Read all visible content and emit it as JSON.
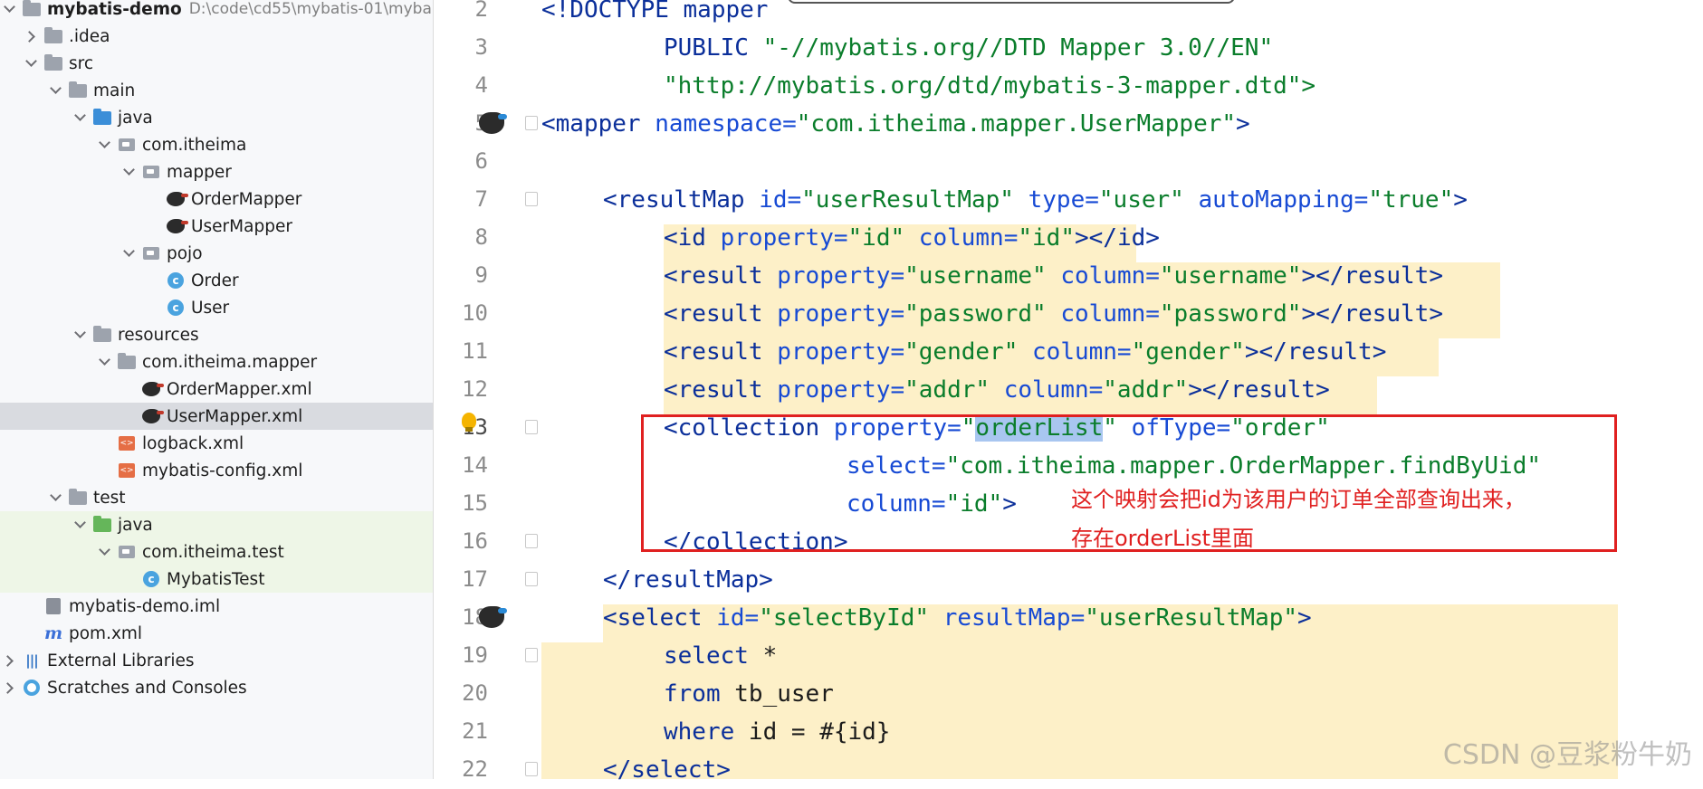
{
  "project_tree": {
    "root": {
      "name": "mybatis-demo",
      "path": "D:\\code\\cd55\\mybatis-01\\myba"
    },
    "items": [
      {
        "label": ".idea"
      },
      {
        "label": "src"
      },
      {
        "label": "main"
      },
      {
        "label": "java"
      },
      {
        "label": "com.itheima"
      },
      {
        "label": "mapper"
      },
      {
        "label": "OrderMapper"
      },
      {
        "label": "UserMapper"
      },
      {
        "label": "pojo"
      },
      {
        "label": "Order"
      },
      {
        "label": "User"
      },
      {
        "label": "resources"
      },
      {
        "label": "com.itheima.mapper"
      },
      {
        "label": "OrderMapper.xml"
      },
      {
        "label": "UserMapper.xml"
      },
      {
        "label": "logback.xml"
      },
      {
        "label": "mybatis-config.xml"
      },
      {
        "label": "test"
      },
      {
        "label": "java"
      },
      {
        "label": "com.itheima.test"
      },
      {
        "label": "MybatisTest"
      },
      {
        "label": "mybatis-demo.iml"
      },
      {
        "label": "pom.xml"
      },
      {
        "label": "External Libraries"
      },
      {
        "label": "Scratches and Consoles"
      }
    ]
  },
  "editor": {
    "line_numbers": [
      "2",
      "3",
      "4",
      "5",
      "6",
      "7",
      "8",
      "9",
      "10",
      "11",
      "12",
      "13",
      "14",
      "15",
      "16",
      "17",
      "18",
      "19",
      "20",
      "21",
      "22"
    ],
    "code": {
      "l2": "<!DOCTYPE mapper",
      "l3_a": "PUBLIC ",
      "l3_b": "\"-//mybatis.org//DTD Mapper 3.0//EN\"",
      "l4": "\"http://mybatis.org/dtd/mybatis-3-mapper.dtd\">",
      "l5_tag": "<mapper ",
      "l5_attr": "namespace=",
      "l5_val": "\"com.itheima.mapper.UserMapper\"",
      "l5_end": ">",
      "l7_tag": "<resultMap ",
      "l7_a1": "id=",
      "l7_v1": "\"userResultMap\"",
      "l7_a2": " type=",
      "l7_v2": "\"user\"",
      "l7_a3": " autoMapping=",
      "l7_v3": "\"true\"",
      "l7_end": ">",
      "l8_tag": "<id ",
      "l8_a1": "property=",
      "l8_v1": "\"id\"",
      "l8_a2": " column=",
      "l8_v2": "\"id\"",
      "l8_end": "></id>",
      "l9_tag": "<result ",
      "l9_a1": "property=",
      "l9_v1": "\"username\"",
      "l9_a2": " column=",
      "l9_v2": "\"username\"",
      "l9_end": "></result>",
      "l10_tag": "<result ",
      "l10_a1": "property=",
      "l10_v1": "\"password\"",
      "l10_a2": " column=",
      "l10_v2": "\"password\"",
      "l10_end": "></result>",
      "l11_tag": "<result ",
      "l11_a1": "property=",
      "l11_v1": "\"gender\"",
      "l11_a2": " column=",
      "l11_v2": "\"gender\"",
      "l11_end": "></result>",
      "l12_tag": "<result ",
      "l12_a1": "property=",
      "l12_v1": "\"addr\"",
      "l12_a2": " column=",
      "l12_v2": "\"addr\"",
      "l12_end": "></result>",
      "l13_tag": "<collection ",
      "l13_a1": "property=",
      "l13_v1a": "\"",
      "l13_v1sel": "orderList",
      "l13_v1b": "\"",
      "l13_a2": " ofType=",
      "l13_v2": "\"order\"",
      "l14_a": "select=",
      "l14_v": "\"com.itheima.mapper.OrderMapper.findByUid\"",
      "l15_a": "column=",
      "l15_v": "\"id\"",
      "l15_end": ">",
      "l16": "</collection>",
      "l17": "</resultMap>",
      "l18_tag": "<select ",
      "l18_a1": "id=",
      "l18_v1": "\"selectById\"",
      "l18_a2": " resultMap=",
      "l18_v2": "\"userResultMap\"",
      "l18_end": ">",
      "l19_kw": "select ",
      "l19_rest": "*",
      "l20_kw": "from ",
      "l20_rest": "tb_user",
      "l21_kw": "where ",
      "l21_rest": "id = #{id}",
      "l22": "</select>"
    },
    "annotation": {
      "line1": "这个映射会把id为该用户的订单全部查询出来，",
      "line2": "存在orderList里面"
    }
  },
  "watermark": "CSDN @豆浆粉牛奶",
  "colors": {
    "annotation": "#e02020",
    "highlight": "#fdf0c8",
    "tag": "#0b2f9a",
    "string": "#0a7d2b"
  }
}
